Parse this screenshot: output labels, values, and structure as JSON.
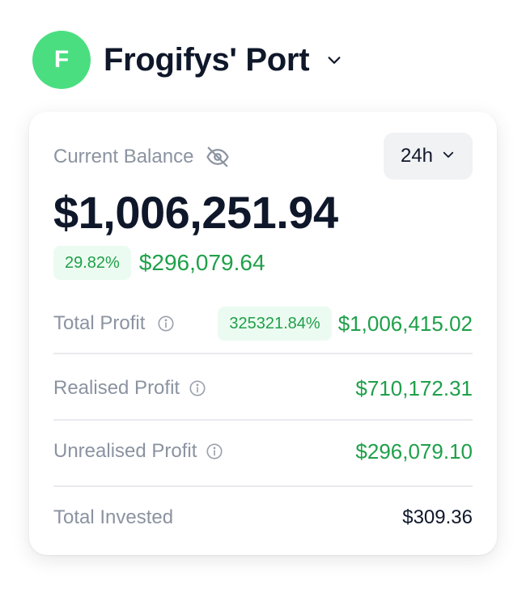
{
  "colors": {
    "accent_green": "#4ade80",
    "profit_green": "#1fa04a",
    "badge_bg": "#ecfbf1",
    "text_dark": "#0f172a",
    "text_muted": "#8b93a1"
  },
  "header": {
    "avatar_letter": "F",
    "title": "Frogifys' Port",
    "dropdown_icon": "chevron-down-icon"
  },
  "card": {
    "balance_label": "Current Balance",
    "hide_icon": "eye-off-icon",
    "period": {
      "selected": "24h",
      "icon": "chevron-down-icon"
    },
    "balance": "$1,006,251.94",
    "change": {
      "percent": "29.82%",
      "amount": "$296,079.64"
    },
    "rows": {
      "total_profit": {
        "label": "Total Profit",
        "icon": "info-icon",
        "percent": "325321.84%",
        "value": "$1,006,415.02"
      },
      "realised_profit": {
        "label": "Realised Profit",
        "icon": "info-icon",
        "value": "$710,172.31"
      },
      "unrealised_profit": {
        "label": "Unrealised Profit",
        "icon": "info-icon",
        "value": "$296,079.10"
      },
      "total_invested": {
        "label": "Total Invested",
        "value": "$309.36"
      }
    }
  }
}
